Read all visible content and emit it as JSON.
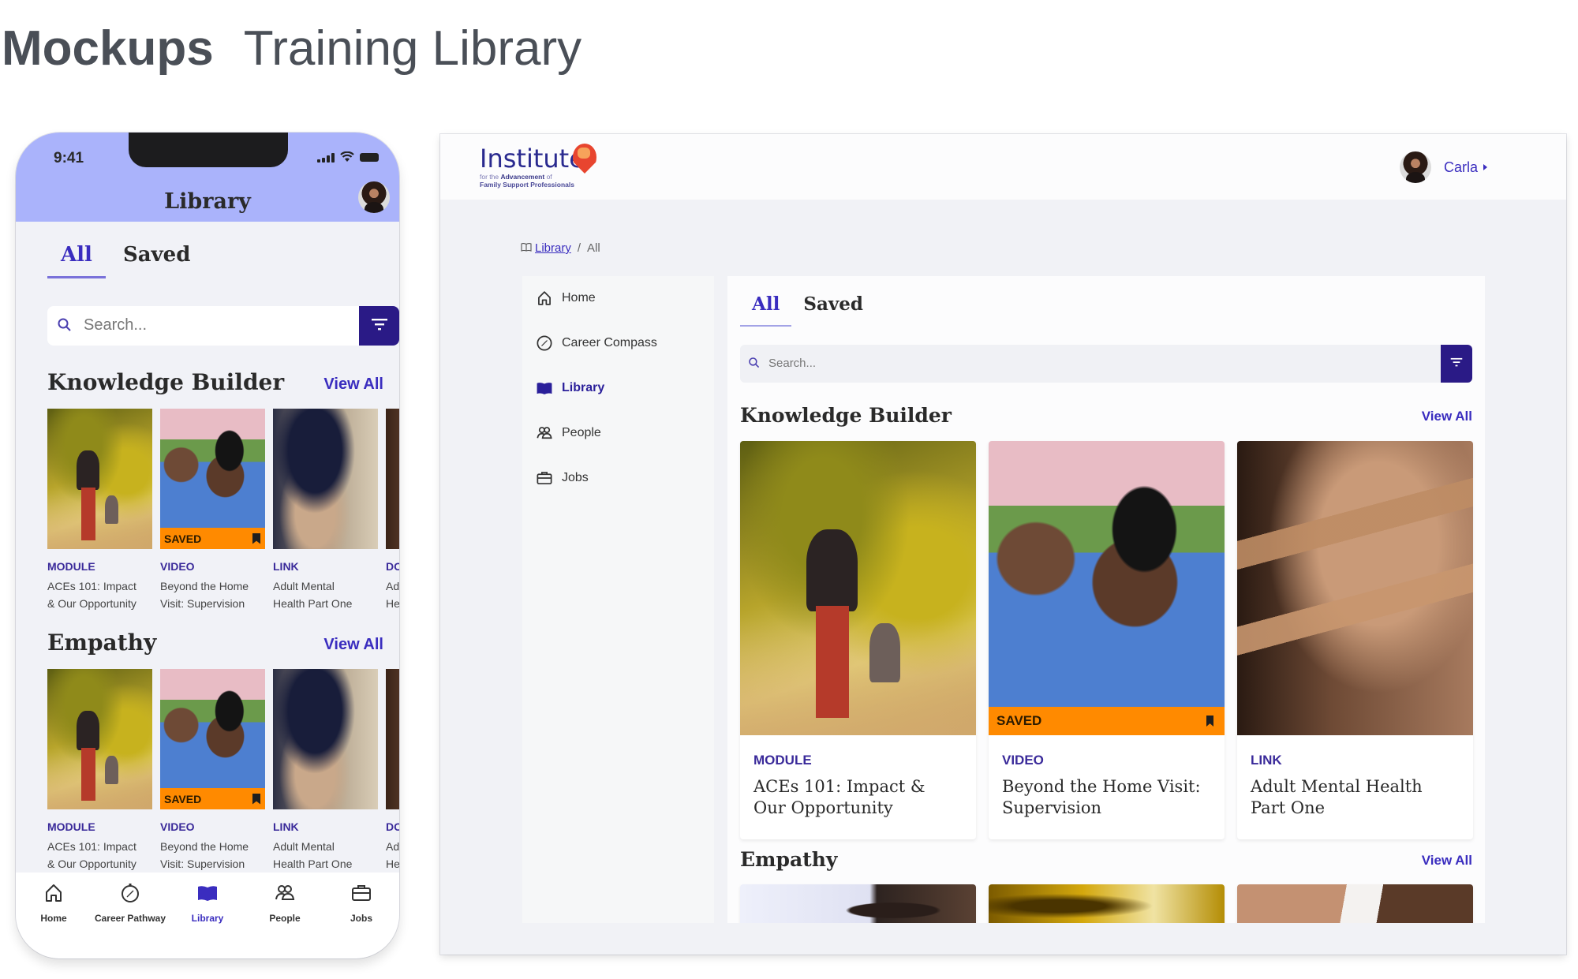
{
  "page": {
    "title_bold": "Mockups",
    "title_sub": "Training Library"
  },
  "colors": {
    "accent": "#3a2dbf",
    "filter_button": "#2a1a86",
    "saved_badge": "#ff8a00",
    "phone_header": "#aab3fb"
  },
  "phone": {
    "status": {
      "time": "9:41",
      "icons": [
        "signal-icon",
        "wifi-icon",
        "battery-icon"
      ]
    },
    "header_title": "Library",
    "tabs": [
      {
        "label": "All",
        "active": true
      },
      {
        "label": "Saved",
        "active": false
      }
    ],
    "search": {
      "placeholder": "Search...",
      "icon": "search-icon",
      "filter_icon": "filter-icon"
    },
    "sections": [
      {
        "title": "Knowledge Builder",
        "view_all": "View All",
        "cards": [
          {
            "type": "MODULE",
            "title_l1": "ACEs 101: Impact",
            "title_l2": "& Our Opportunity",
            "saved": false
          },
          {
            "type": "VIDEO",
            "title_l1": "Beyond the Home",
            "title_l2": "Visit: Supervision",
            "saved": true,
            "saved_label": "SAVED"
          },
          {
            "type": "LINK",
            "title_l1": "Adult Mental",
            "title_l2": "Health Part One",
            "saved": false
          },
          {
            "type": "DOW",
            "title_l1": "Adult",
            "title_l2": "Healt",
            "saved": false
          }
        ]
      },
      {
        "title": "Empathy",
        "view_all": "View All",
        "cards": [
          {
            "type": "MODULE",
            "title_l1": "ACEs 101: Impact",
            "title_l2": "& Our Opportunity",
            "saved": false
          },
          {
            "type": "VIDEO",
            "title_l1": "Beyond the Home",
            "title_l2": "Visit: Supervision",
            "saved": true,
            "saved_label": "SAVED"
          },
          {
            "type": "LINK",
            "title_l1": "Adult Mental",
            "title_l2": "Health Part One",
            "saved": false
          },
          {
            "type": "DOW",
            "title_l1": "Adult",
            "title_l2": "Healt",
            "saved": false
          }
        ]
      }
    ],
    "nav": [
      {
        "label": "Home",
        "icon": "home-icon",
        "active": false
      },
      {
        "label": "Career Pathway",
        "icon": "compass-icon",
        "active": false
      },
      {
        "label": "Library",
        "icon": "book-icon",
        "active": true
      },
      {
        "label": "People",
        "icon": "people-icon",
        "active": false
      },
      {
        "label": "Jobs",
        "icon": "briefcase-icon",
        "active": false
      }
    ]
  },
  "desktop": {
    "logo": {
      "word": "Institute",
      "line2_pre": "for the ",
      "line2_bold": "Advancement",
      "line2_post": " of",
      "line3": "Family Support Professionals"
    },
    "user": {
      "name": "Carla"
    },
    "breadcrumb": {
      "link": "Library",
      "sep": "/",
      "current": "All"
    },
    "sidebar": [
      {
        "label": "Home",
        "icon": "home-icon",
        "active": false
      },
      {
        "label": "Career Compass",
        "icon": "compass-icon",
        "active": false
      },
      {
        "label": "Library",
        "icon": "book-icon",
        "active": true
      },
      {
        "label": "People",
        "icon": "people-icon",
        "active": false
      },
      {
        "label": "Jobs",
        "icon": "briefcase-icon",
        "active": false
      }
    ],
    "tabs": [
      {
        "label": "All",
        "active": true
      },
      {
        "label": "Saved",
        "active": false
      }
    ],
    "search": {
      "placeholder": "Search..."
    },
    "sections": [
      {
        "title": "Knowledge Builder",
        "view_all": "View All",
        "cards": [
          {
            "type": "MODULE",
            "title": "ACEs 101: Impact & Our Opportunity",
            "saved": false
          },
          {
            "type": "VIDEO",
            "title": "Beyond the Home Visit: Supervision",
            "saved": true,
            "saved_label": "SAVED"
          },
          {
            "type": "LINK",
            "title": "Adult Mental Health Part One",
            "saved": false
          }
        ]
      },
      {
        "title": "Empathy",
        "view_all": "View All"
      }
    ]
  }
}
